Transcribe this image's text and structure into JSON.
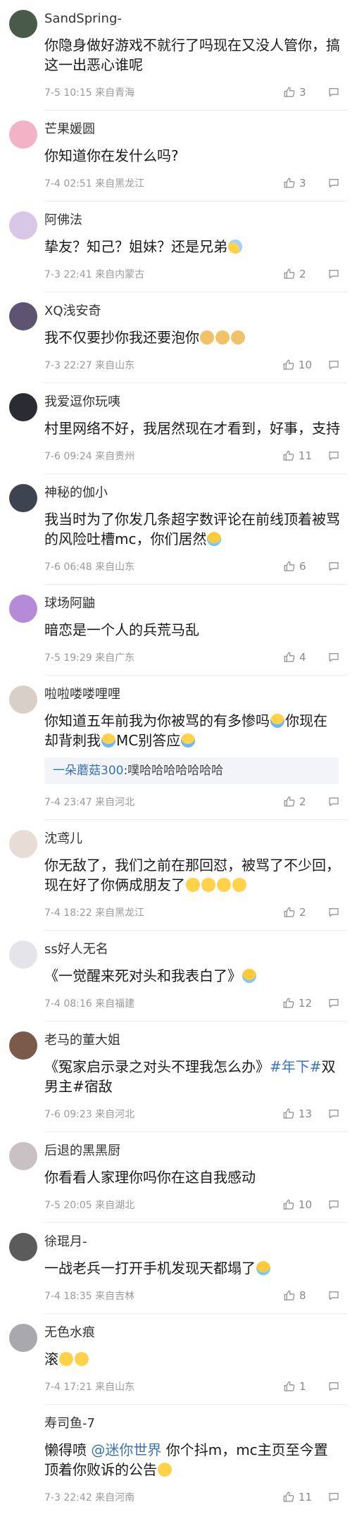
{
  "comments": [
    {
      "name": "SandSpring-",
      "text": "你隐身做好游戏不就行了吗现在又没人管你，搞这一出恶心谁呢",
      "time": "7-5 10:15 来自青海",
      "likes": "3",
      "avatar_color": "#4a5a4a"
    },
    {
      "name": "芒果媛圆",
      "text": "你知道你在发什么吗?",
      "time": "7-4 02:51 来自黑龙江",
      "likes": "3",
      "avatar_color": "#f2b3c6"
    },
    {
      "name": "阿佛法",
      "text": "挚友？知己？姐妹？还是兄弟",
      "emoji": "sweat-emoji",
      "time": "7-3 22:41 来自内蒙古",
      "likes": "2",
      "avatar_color": "#d9c7e8"
    },
    {
      "name": "XQ浅安奇",
      "text": "我不仅要抄你我还要泡你",
      "emoji": "doge-emoji",
      "time": "7-3 22:27 来自山东",
      "likes": "10",
      "avatar_color": "#5c5470"
    },
    {
      "name": "我爱逗你玩咦",
      "text": "村里网络不好，我居然现在才看到，好事，支持",
      "time": "7-6 09:24 来自贵州",
      "likes": "11",
      "avatar_color": "#2b2b33"
    },
    {
      "name": "神秘的伽小",
      "text": "我当时为了你发几条超字数评论在前线顶着被骂的风险吐槽mc，你们居然",
      "emoji": "laugh-cry-emoji",
      "time": "7-6 06:48 来自山东",
      "likes": "6",
      "avatar_color": "#3d4450"
    },
    {
      "name": "球场阿鼬",
      "text": "暗恋是一个人的兵荒马乱",
      "time": "7-5 19:29 来自广东",
      "likes": "4",
      "avatar_color": "#b58ad6"
    },
    {
      "name": "啦啦喽喽哩哩",
      "text_parts": [
        "你知道五年前我为你被骂的有多惨吗",
        "你现在却背刺我",
        "MC别答应"
      ],
      "emoji": "cry-emoji",
      "reply_name": "一朵蘑菇300",
      "reply_text": ":噗哈哈哈哈哈哈哈",
      "time": "7-4 23:47 来自河北",
      "likes": "2",
      "avatar_color": "#d8d0c8"
    },
    {
      "name": "沈鸢儿",
      "text": "你无敌了，我们之前在那回怼，被骂了不少回，现在好了你俩成朋友了",
      "emoji": "smile-emoji",
      "time": "7-4 18:22 来自黑龙江",
      "likes": "2",
      "avatar_color": "#e7dcd6"
    },
    {
      "name": "ss好人无名",
      "text": "《一觉醒来死对头和我表白了》",
      "emoji": "laugh-cry-emoji",
      "time": "7-4 08:16 来自福建",
      "likes": "12",
      "avatar_color": "#e4e4ea"
    },
    {
      "name": "老马的董大姐",
      "text_before": "《冤家启示录之对头不理我怎么办》",
      "topic": "#年下#",
      "text_after": "双男主#宿敌",
      "time": "7-6 09:23 来自河北",
      "likes": "13",
      "avatar_color": "#7a5a48"
    },
    {
      "name": "后退的黑黑厨",
      "text": "你看看人家理你吗你在这自我感动",
      "time": "7-5 20:05 来自湖北",
      "likes": "10",
      "avatar_color": "#c9c0c4"
    },
    {
      "name": "徐琨月-",
      "text": "一战老兵一打开手机发现天都塌了",
      "emoji": "laugh-cry-emoji",
      "time": "7-4 18:35 来自吉林",
      "likes": "8",
      "avatar_color": "#5b5b5b"
    },
    {
      "name": "无色水痕",
      "text": "滚",
      "emoji": "smile-emoji",
      "time": "7-4 17:21 来自山东",
      "likes": "1",
      "avatar_color": "#a9a9ad"
    },
    {
      "name": "寿司鱼-7",
      "text_before": "懒得喷 ",
      "mention": "@迷你世界",
      "text_after": " 你个抖m，mc主页至今置顶着你败诉的公告",
      "emoji": "shy-emoji",
      "time": "7-3 22:42 来自河南",
      "likes": "11",
      "avatar_color": "#ffffff"
    }
  ],
  "colors": {
    "link": "#3a73b8",
    "meta": "#9a9a9a",
    "divider": "#ececec"
  },
  "icons": {
    "like": "thumbs-up-icon",
    "reply": "comment-bubble-icon"
  }
}
